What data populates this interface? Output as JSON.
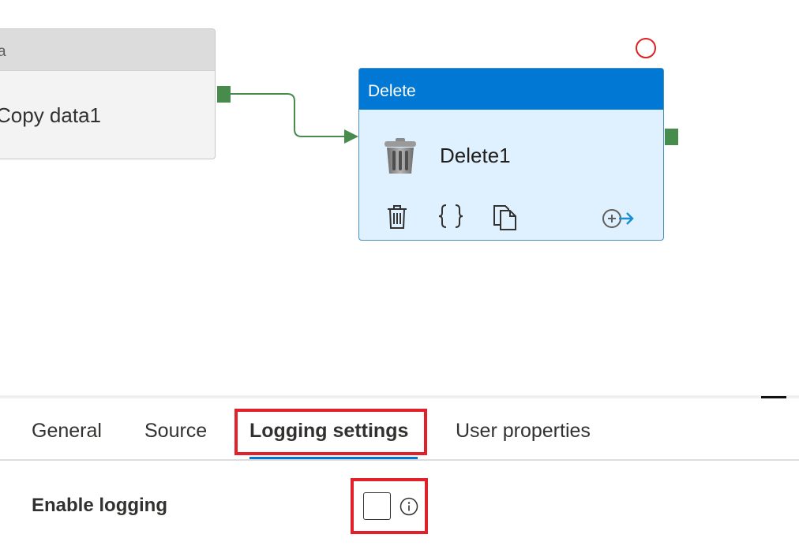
{
  "canvas": {
    "copy_activity": {
      "header_text": "a",
      "name": "Copy data1"
    },
    "delete_activity": {
      "header_text": "Delete",
      "name": "Delete1",
      "action_icons": [
        "delete-icon",
        "code-icon",
        "copy-icon",
        "add-output-icon"
      ]
    },
    "connector_color": "#478b4d",
    "accent": "#0078d4"
  },
  "panel": {
    "tabs": [
      {
        "label": "General",
        "active": false
      },
      {
        "label": "Source",
        "active": false
      },
      {
        "label": "Logging settings",
        "active": true
      },
      {
        "label": "User properties",
        "active": false
      }
    ],
    "enable_logging": {
      "label": "Enable logging",
      "checked": false
    }
  },
  "highlight_color": "#e0202a"
}
